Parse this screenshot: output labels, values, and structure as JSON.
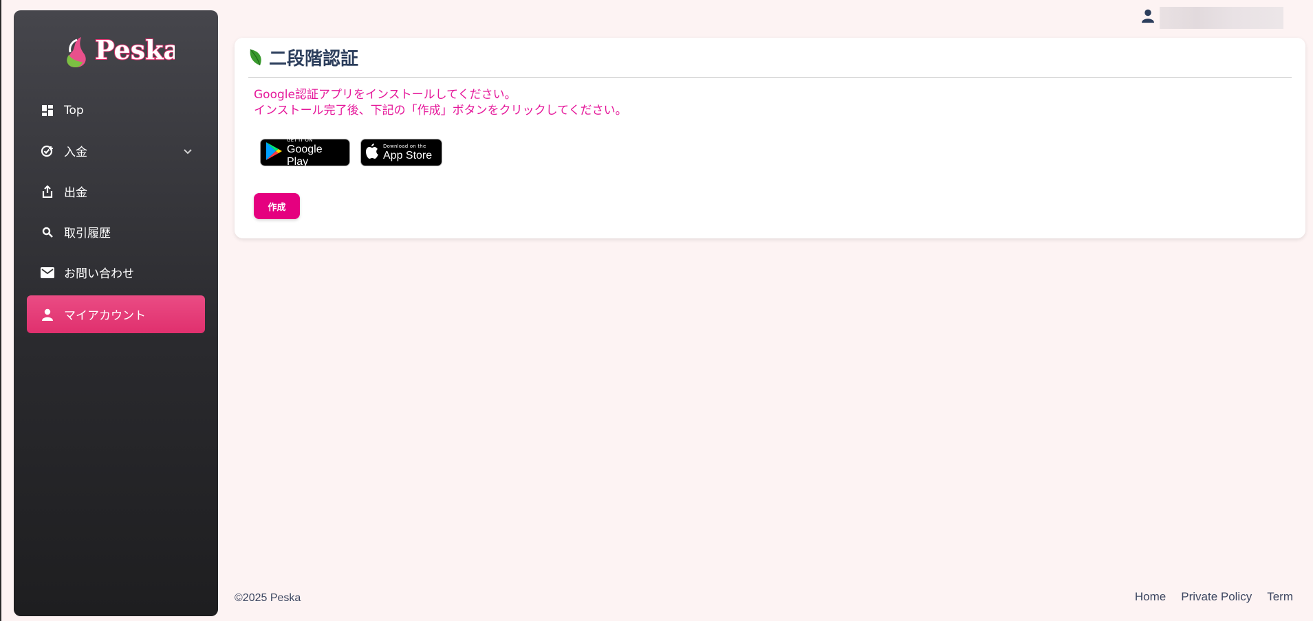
{
  "brand": {
    "logo_text": "Peska",
    "colors": {
      "accent": "#e5007f",
      "active_nav": "#e63b7a",
      "message": "#e5189a"
    }
  },
  "sidebar": {
    "items": [
      {
        "label": "Top",
        "icon": "dashboard-icon"
      },
      {
        "label": "入金",
        "icon": "deposit-icon",
        "has_chevron": true
      },
      {
        "label": "出金",
        "icon": "withdraw-icon"
      },
      {
        "label": "取引履歴",
        "icon": "search-icon"
      },
      {
        "label": "お問い合わせ",
        "icon": "mail-icon"
      },
      {
        "label": "マイアカウント",
        "icon": "user-icon",
        "active": true
      }
    ]
  },
  "header": {
    "user_icon": "user-icon"
  },
  "card": {
    "title": "二段階認証",
    "message_line1": "Google認証アプリをインストールしてください。",
    "message_line2": "インストール完了後、下記の「作成」ボタンをクリックしてください。",
    "google_play": {
      "small": "GET IT ON",
      "big": "Google Play"
    },
    "app_store": {
      "small": "Download on the",
      "big": "App Store"
    },
    "create_button": "作成"
  },
  "footer": {
    "copyright": "©2025 Peska",
    "links": [
      "Home",
      "Private Policy",
      "Term"
    ]
  }
}
